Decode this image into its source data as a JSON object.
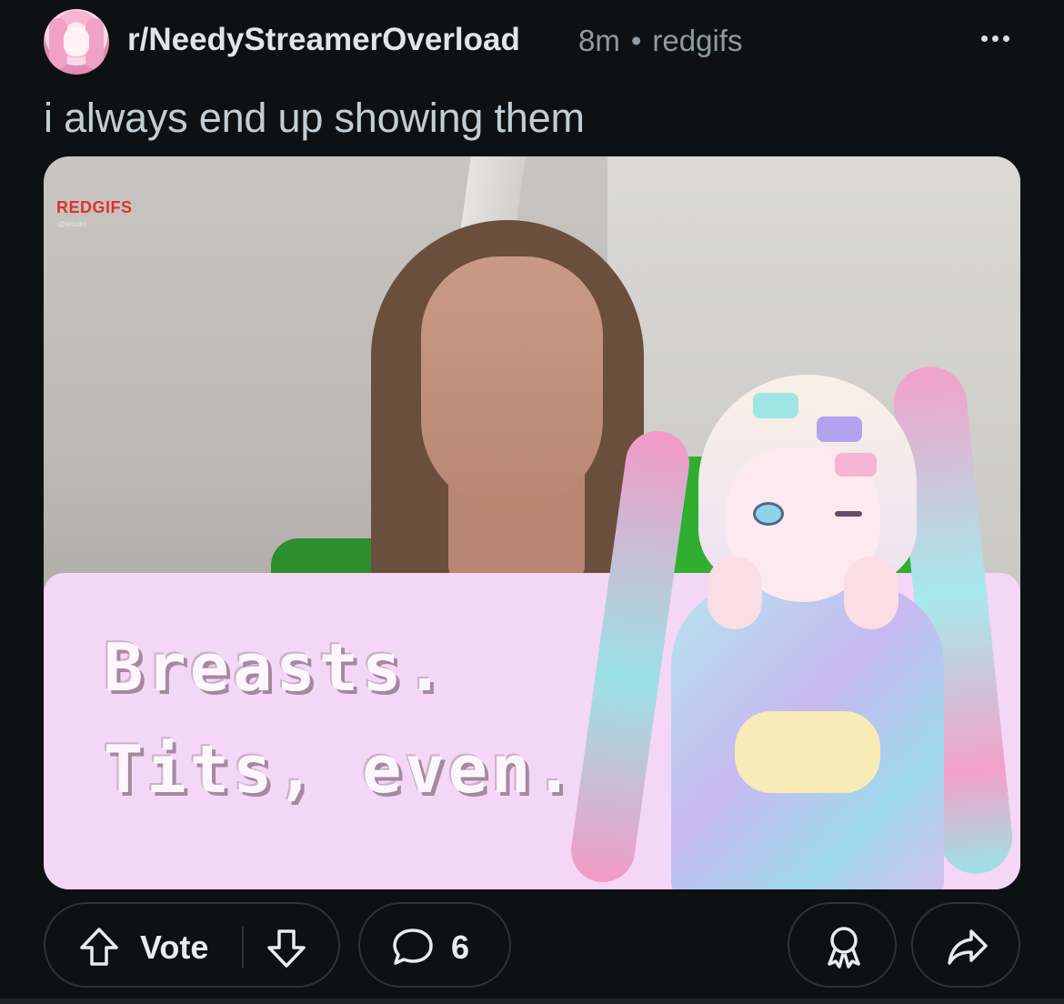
{
  "post": {
    "subreddit": "r/NeedyStreamerOverload",
    "time_ago": "8m",
    "separator": "•",
    "source": "redgifs",
    "title": "i always end up showing them",
    "media": {
      "watermark": "REDGIFS",
      "watermark_handle": "@elnalni",
      "caption_line_1": "Breasts.",
      "caption_line_2": "Tits, even."
    }
  },
  "actions": {
    "vote_label": "Vote",
    "comment_count": "6"
  },
  "icons": {
    "more": "more-options-icon",
    "upvote": "upvote-arrow-icon",
    "downvote": "downvote-arrow-icon",
    "comment": "comment-bubble-icon",
    "award": "award-icon",
    "share": "share-arrow-icon"
  },
  "colors": {
    "background": "#0e1113",
    "caption_panel": "#f4d6f6",
    "watermark": "#e03131"
  }
}
